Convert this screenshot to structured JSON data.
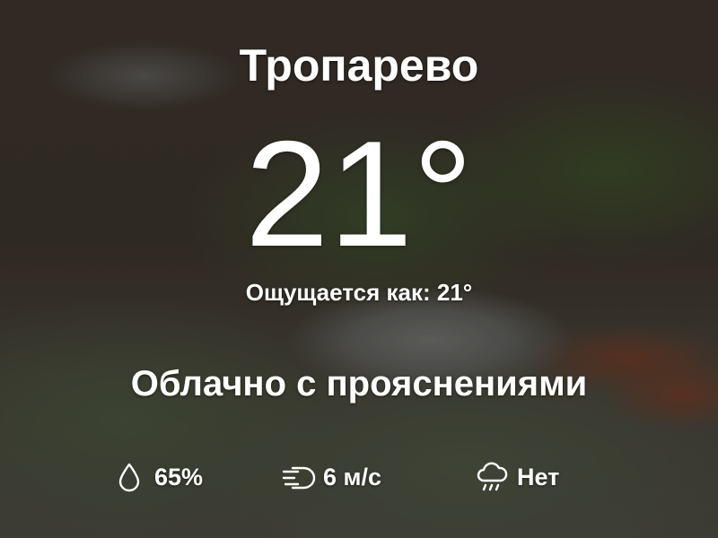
{
  "location": {
    "city": "Тропарево"
  },
  "current": {
    "temperature": "21°",
    "feels_like": "Ощущается как: 21°",
    "condition": "Облачно с прояснениями"
  },
  "details": {
    "humidity": {
      "icon": "droplet-icon",
      "value": "65%"
    },
    "wind": {
      "icon": "wind-icon",
      "value": "6 м/с"
    },
    "precipitation": {
      "icon": "rain-cloud-icon",
      "value": "Нет"
    }
  },
  "colors": {
    "text": "#ffffff"
  }
}
